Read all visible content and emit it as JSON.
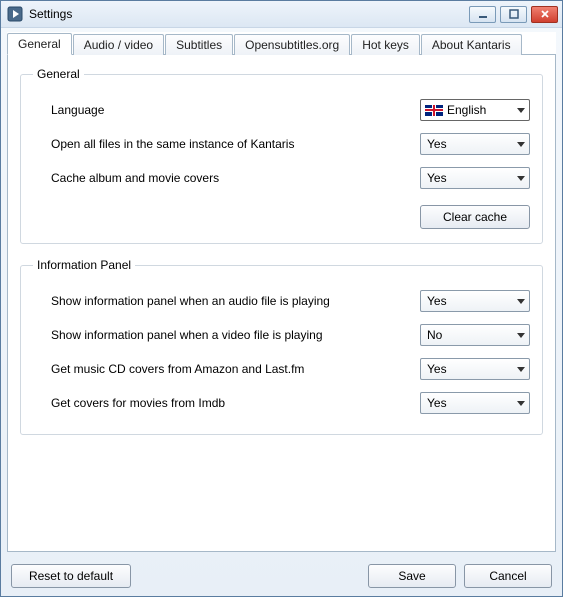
{
  "window": {
    "title": "Settings"
  },
  "tabs": [
    {
      "label": "General",
      "active": true
    },
    {
      "label": "Audio / video"
    },
    {
      "label": "Subtitles"
    },
    {
      "label": "Opensubtitles.org"
    },
    {
      "label": "Hot keys"
    },
    {
      "label": "About Kantaris"
    }
  ],
  "general": {
    "legend": "General",
    "language_label": "Language",
    "language_value": "English",
    "same_instance_label": "Open all files in the same instance of Kantaris",
    "same_instance_value": "Yes",
    "cache_covers_label": "Cache album and movie covers",
    "cache_covers_value": "Yes",
    "clear_cache_label": "Clear cache"
  },
  "info_panel": {
    "legend": "Information Panel",
    "audio_label": "Show information panel when an audio file is playing",
    "audio_value": "Yes",
    "video_label": "Show information panel when a video file is playing",
    "video_value": "No",
    "cd_covers_label": "Get music CD covers from Amazon and Last.fm",
    "cd_covers_value": "Yes",
    "movie_covers_label": "Get covers for movies from Imdb",
    "movie_covers_value": "Yes"
  },
  "footer": {
    "reset_label": "Reset to default",
    "save_label": "Save",
    "cancel_label": "Cancel"
  }
}
